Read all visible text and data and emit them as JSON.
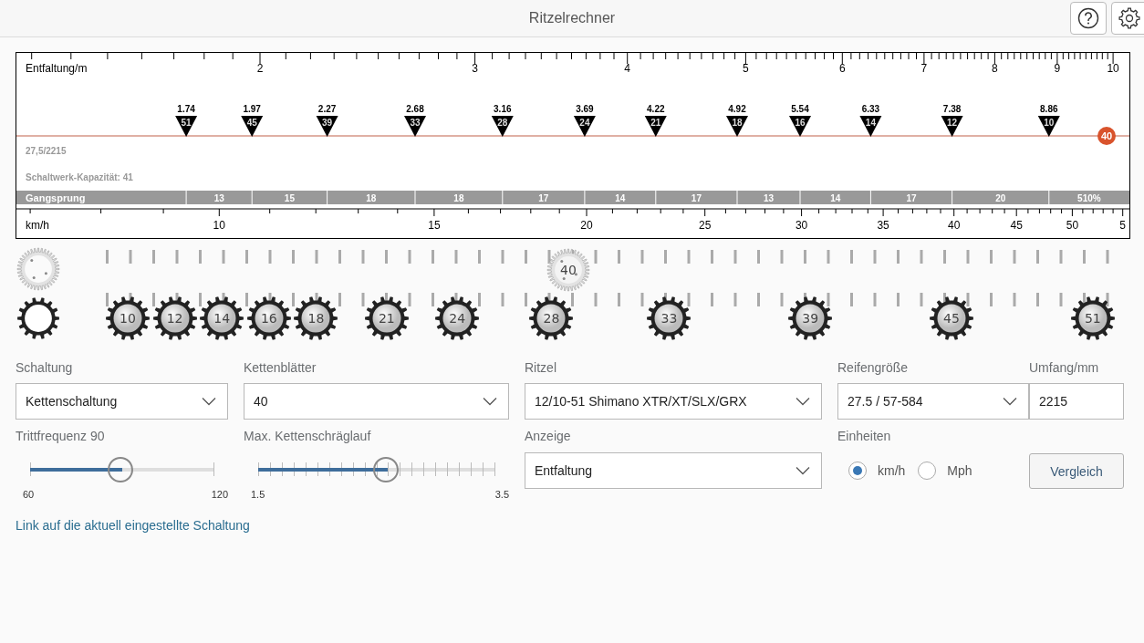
{
  "header": {
    "title": "Ritzelrechner"
  },
  "chart": {
    "top_axis": {
      "label": "Entfaltung/m",
      "ticks": [
        "2",
        "3",
        "4",
        "5",
        "6",
        "7",
        "8",
        "9",
        "10"
      ]
    },
    "markers": [
      {
        "value": "1.74",
        "teeth": "51"
      },
      {
        "value": "1.97",
        "teeth": "45"
      },
      {
        "value": "2.27",
        "teeth": "39"
      },
      {
        "value": "2.68",
        "teeth": "33"
      },
      {
        "value": "3.16",
        "teeth": "28"
      },
      {
        "value": "3.69",
        "teeth": "24"
      },
      {
        "value": "4.22",
        "teeth": "21"
      },
      {
        "value": "4.92",
        "teeth": "18"
      },
      {
        "value": "5.54",
        "teeth": "16"
      },
      {
        "value": "6.33",
        "teeth": "14"
      },
      {
        "value": "7.38",
        "teeth": "12"
      },
      {
        "value": "8.86",
        "teeth": "10"
      }
    ],
    "chainring_badge": "40",
    "tire_info": "27,5/2215",
    "capacity": "Schaltwerk-Kapazität: 41",
    "gear_steps": {
      "label": "Gangsprung",
      "steps": [
        "13",
        "15",
        "18",
        "18",
        "17",
        "14",
        "17",
        "13",
        "14",
        "17",
        "20"
      ],
      "total": "510%"
    },
    "bottom_axis": {
      "label": "km/h",
      "ticks": [
        "10",
        "15",
        "20",
        "25",
        "30",
        "35",
        "40",
        "45",
        "50",
        "5"
      ]
    }
  },
  "drivetrain": {
    "chainrings": [
      "40"
    ],
    "cogs": [
      "10",
      "12",
      "14",
      "16",
      "18",
      "21",
      "24",
      "28",
      "33",
      "39",
      "45",
      "51"
    ]
  },
  "form": {
    "shifting": {
      "label": "Schaltung",
      "value": "Kettenschaltung"
    },
    "chainrings": {
      "label": "Kettenblätter",
      "value": "40"
    },
    "cassette": {
      "label": "Ritzel",
      "value": "12/10-51 Shimano XTR/XT/SLX/GRX"
    },
    "tire": {
      "label": "Reifengröße",
      "value": "27.5 / 57-584"
    },
    "circumference": {
      "label": "Umfang/mm",
      "value": "2215"
    },
    "cadence": {
      "label": "Trittfrequenz 90",
      "min": "60",
      "max": "120",
      "level": 0.5
    },
    "chain_angle": {
      "label": "Max. Kettenschräglauf",
      "min": "1.5",
      "max": "3.5",
      "level": 0.55
    },
    "display": {
      "label": "Anzeige",
      "value": "Entfaltung"
    },
    "units": {
      "label": "Einheiten",
      "options": [
        {
          "label": "km/h",
          "selected": true
        },
        {
          "label": "Mph",
          "selected": false
        }
      ]
    },
    "compare_button": "Vergleich",
    "link": "Link auf die aktuell eingestellte Schaltung"
  }
}
